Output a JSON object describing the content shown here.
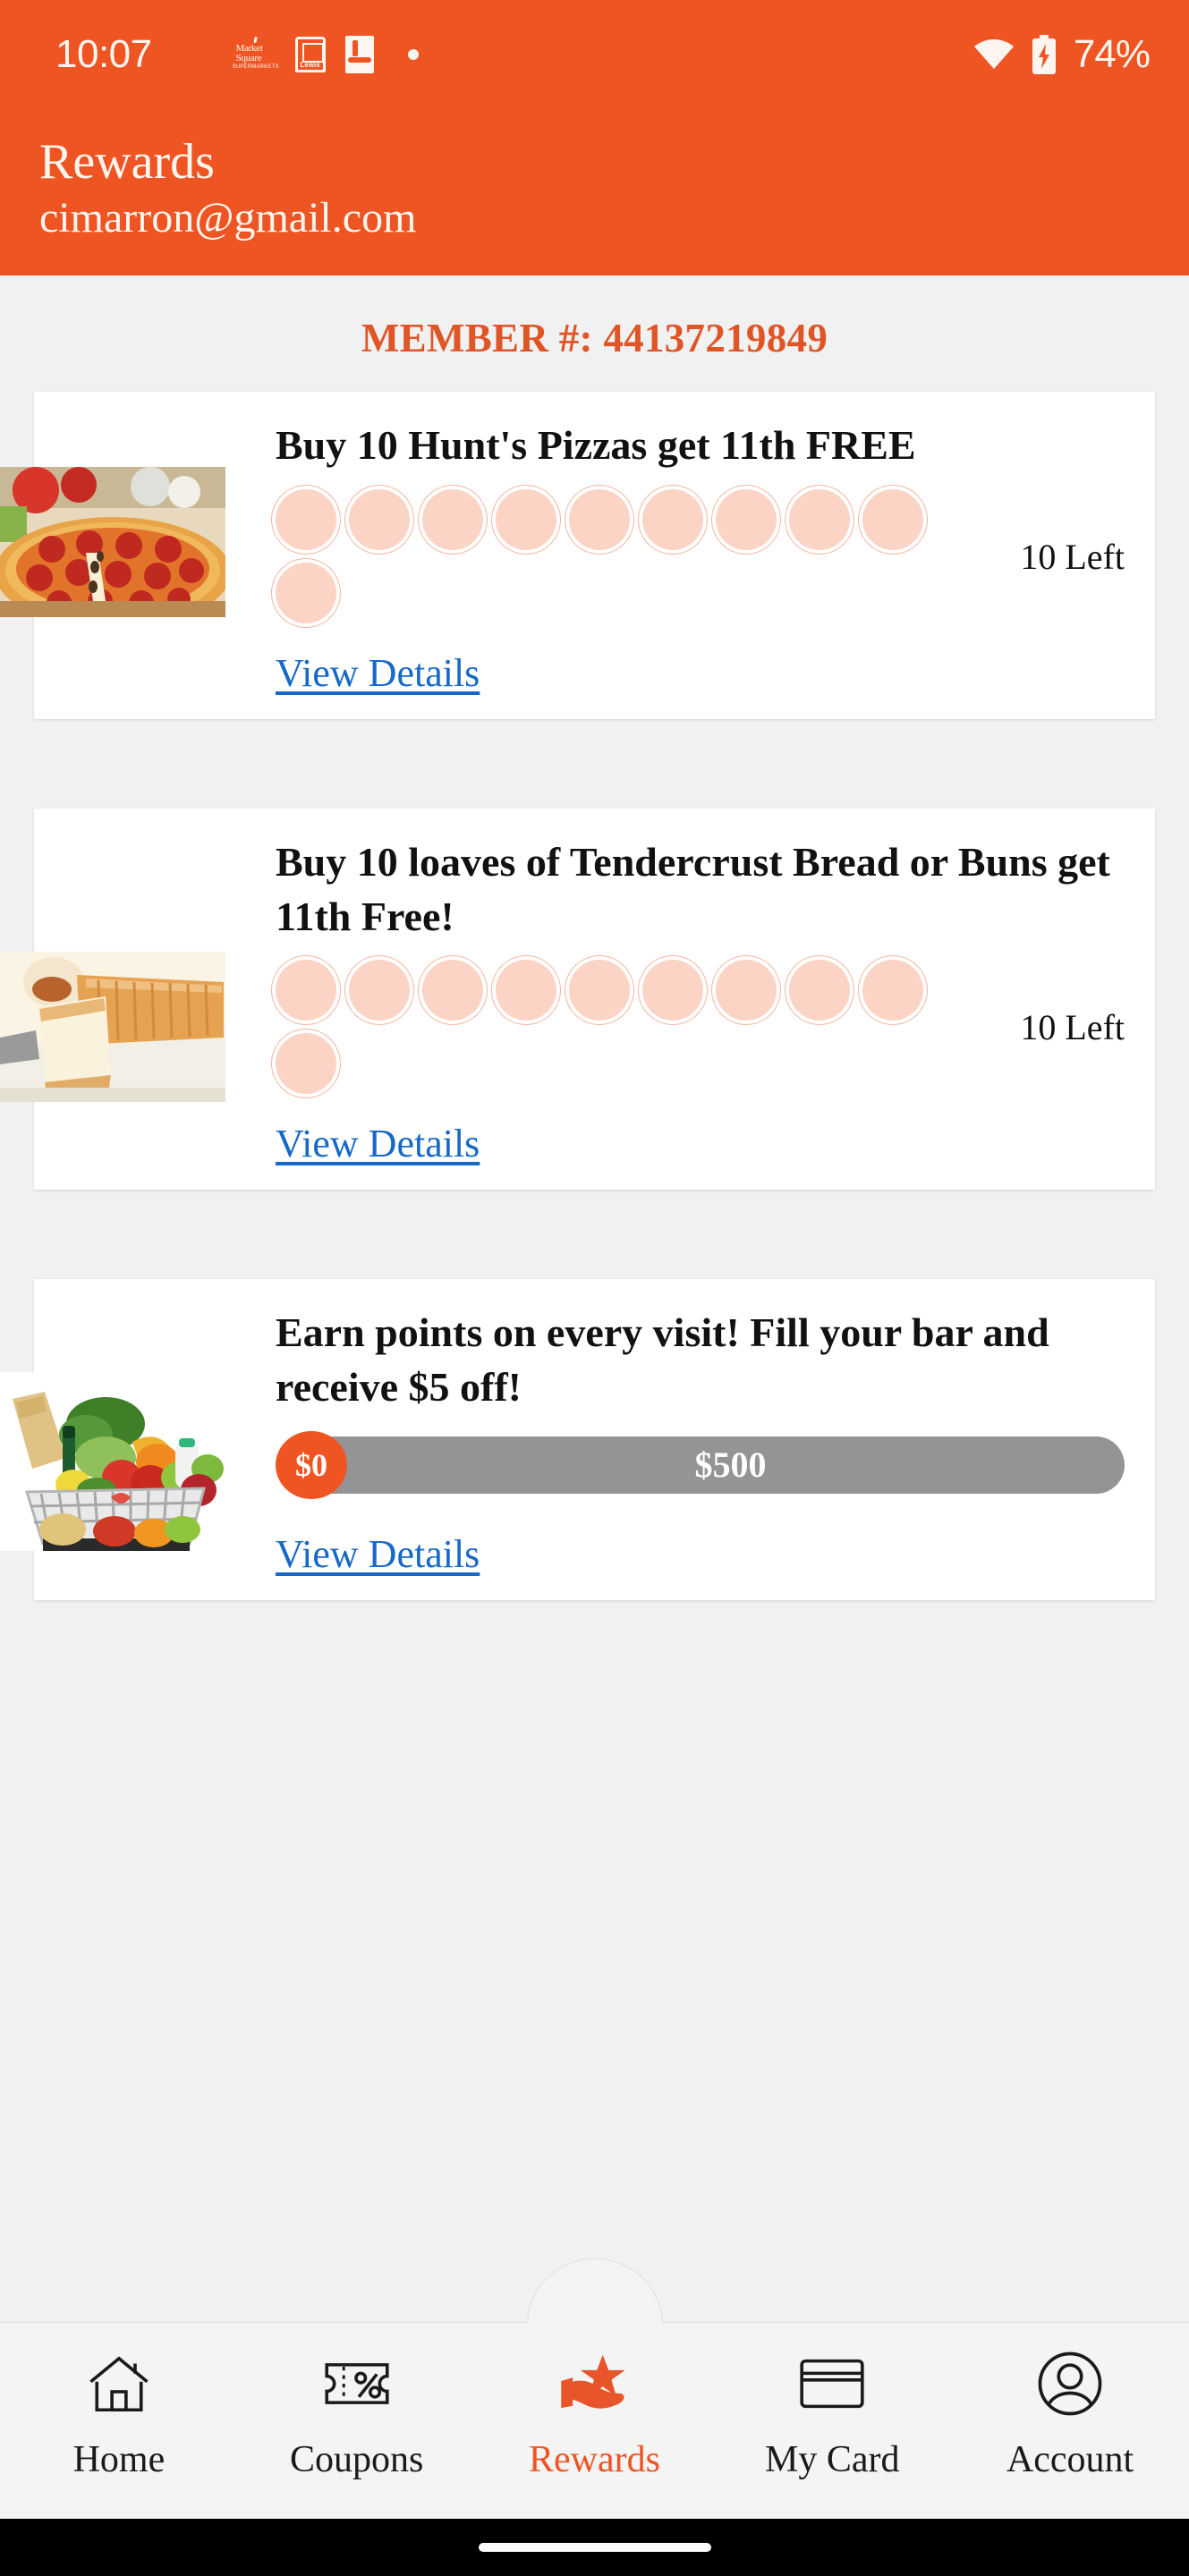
{
  "colors": {
    "brand_orange": "#EF5522",
    "member_orange": "#E05526",
    "link_blue": "#1769C7",
    "stamp_fill": "#FBD4C5",
    "stamp_ring": "#F3B6A0",
    "progress_track": "#949494",
    "page_bg": "#F1F1F1",
    "card_bg": "#FFFFFF",
    "nav_bg": "#F4F4F4"
  },
  "status_bar": {
    "time": "10:07",
    "notification_icons": [
      "strawberry-app-icon",
      "market-square-supermarkets-icon",
      "lewis-cart-icon",
      "champagnes-market-icon",
      "more-notifications-dot"
    ],
    "wifi_icon": "wifi-icon",
    "battery_icon": "battery-charging-icon",
    "battery_percent": "74%"
  },
  "header": {
    "title": "Rewards",
    "account_email": "cimarron@gmail.com"
  },
  "member": {
    "label": "MEMBER #: 44137219849"
  },
  "rewards": [
    {
      "title": "Buy 10 Hunt's Pizzas get 11th FREE",
      "thumb_icon": "pepperoni-pizza-photo",
      "type": "stamps",
      "stamp_total": 10,
      "stamps_filled": 0,
      "remaining_label": "10 Left",
      "link_label": "View Details"
    },
    {
      "title": "Buy 10 loaves of Tendercrust Bread or Buns get 11th Free!",
      "thumb_icon": "sliced-bread-loaf-photo",
      "type": "stamps",
      "stamp_total": 10,
      "stamps_filled": 0,
      "remaining_label": "10 Left",
      "link_label": "View Details"
    },
    {
      "title": "Earn points on every visit! Fill your bar and receive $5 off!",
      "thumb_icon": "grocery-basket-produce-photo",
      "type": "progress",
      "progress_current": "$0",
      "progress_goal": "$500",
      "progress_percent": 0,
      "link_label": "View Details"
    }
  ],
  "bottom_nav": {
    "items": [
      {
        "label": "Home",
        "icon": "home-icon",
        "active": false
      },
      {
        "label": "Coupons",
        "icon": "coupon-percent-icon",
        "active": false
      },
      {
        "label": "Rewards",
        "icon": "hand-star-rewards-icon",
        "active": true
      },
      {
        "label": "My Card",
        "icon": "credit-card-icon",
        "active": false
      },
      {
        "label": "Account",
        "icon": "person-circle-icon",
        "active": false
      }
    ]
  }
}
